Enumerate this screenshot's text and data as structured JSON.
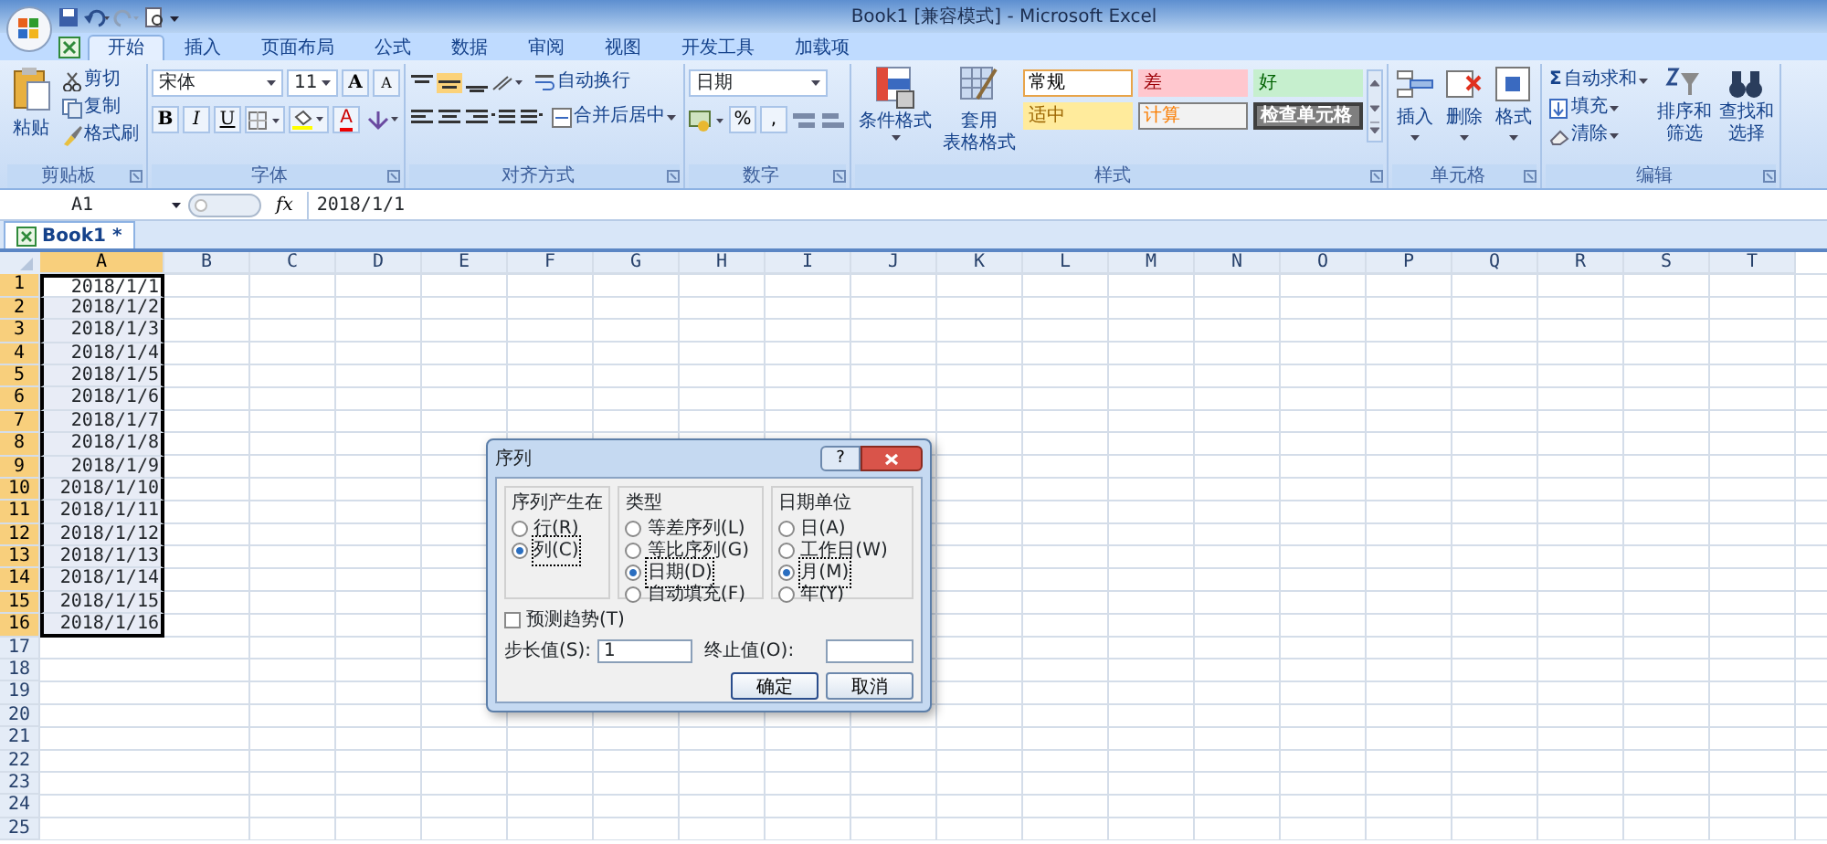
{
  "window": {
    "title": "Book1  [兼容模式] - Microsoft Excel"
  },
  "tabs": [
    {
      "label": "开始",
      "selected": true
    },
    {
      "label": "插入",
      "selected": false
    },
    {
      "label": "页面布局",
      "selected": false
    },
    {
      "label": "公式",
      "selected": false
    },
    {
      "label": "数据",
      "selected": false
    },
    {
      "label": "审阅",
      "selected": false
    },
    {
      "label": "视图",
      "selected": false
    },
    {
      "label": "开发工具",
      "selected": false
    },
    {
      "label": "加载项",
      "selected": false
    }
  ],
  "clipboard": {
    "label": "剪贴板",
    "paste": "粘贴",
    "items": [
      "剪切",
      "复制",
      "格式刷"
    ]
  },
  "font": {
    "label": "字体",
    "name": "宋体",
    "size": "11",
    "grow": "A",
    "shrink": "A",
    "styles": [
      "B",
      "I",
      "U"
    ],
    "color_letter": "A"
  },
  "alignment": {
    "label": "对齐方式",
    "wrap": "自动换行",
    "merge": "合并后居中"
  },
  "number": {
    "label": "数字",
    "format": "日期",
    "percent": "%",
    "comma": ","
  },
  "styles": {
    "label": "样式",
    "conditional": "条件格式",
    "table_lines": [
      "套用",
      "表格格式"
    ],
    "items": [
      {
        "label": "常规",
        "kind": "normal"
      },
      {
        "label": "差",
        "kind": "bad"
      },
      {
        "label": "好",
        "kind": "good"
      },
      {
        "label": "适中",
        "kind": "neutral"
      },
      {
        "label": "计算",
        "kind": "calc"
      },
      {
        "label": "检查单元格",
        "kind": "check"
      }
    ]
  },
  "cells": {
    "label": "单元格",
    "buttons": [
      "插入",
      "删除",
      "格式"
    ]
  },
  "editing": {
    "label": "编辑",
    "sum_symbol": "Σ",
    "items": [
      "自动求和",
      "填充",
      "清除"
    ],
    "buttons": [
      [
        "排序和",
        "筛选"
      ],
      [
        "查找和",
        "选择"
      ]
    ]
  },
  "formula_bar": {
    "name_box": "A1",
    "fx": "fx",
    "formula": "2018/1/1"
  },
  "sheet_tab": {
    "label": "Book1 *"
  },
  "grid": {
    "columns": [
      {
        "label": "A",
        "selected": true
      },
      {
        "label": "B",
        "selected": false
      },
      {
        "label": "C",
        "selected": false
      },
      {
        "label": "D",
        "selected": false
      },
      {
        "label": "E",
        "selected": false
      },
      {
        "label": "F",
        "selected": false
      },
      {
        "label": "G",
        "selected": false
      },
      {
        "label": "H",
        "selected": false
      },
      {
        "label": "I",
        "selected": false
      },
      {
        "label": "J",
        "selected": false
      },
      {
        "label": "K",
        "selected": false
      },
      {
        "label": "L",
        "selected": false
      },
      {
        "label": "M",
        "selected": false
      },
      {
        "label": "N",
        "selected": false
      },
      {
        "label": "O",
        "selected": false
      },
      {
        "label": "P",
        "selected": false
      },
      {
        "label": "Q",
        "selected": false
      },
      {
        "label": "R",
        "selected": false
      },
      {
        "label": "S",
        "selected": false
      },
      {
        "label": "T",
        "selected": false
      }
    ],
    "rows": [
      {
        "label": "1",
        "selected": true,
        "value": "2018/1/1"
      },
      {
        "label": "2",
        "selected": true,
        "value": "2018/1/2"
      },
      {
        "label": "3",
        "selected": true,
        "value": "2018/1/3"
      },
      {
        "label": "4",
        "selected": true,
        "value": "2018/1/4"
      },
      {
        "label": "5",
        "selected": true,
        "value": "2018/1/5"
      },
      {
        "label": "6",
        "selected": true,
        "value": "2018/1/6"
      },
      {
        "label": "7",
        "selected": true,
        "value": "2018/1/7"
      },
      {
        "label": "8",
        "selected": true,
        "value": "2018/1/8"
      },
      {
        "label": "9",
        "selected": true,
        "value": "2018/1/9"
      },
      {
        "label": "10",
        "selected": true,
        "value": "2018/1/10"
      },
      {
        "label": "11",
        "selected": true,
        "value": "2018/1/11"
      },
      {
        "label": "12",
        "selected": true,
        "value": "2018/1/12"
      },
      {
        "label": "13",
        "selected": true,
        "value": "2018/1/13"
      },
      {
        "label": "14",
        "selected": true,
        "value": "2018/1/14"
      },
      {
        "label": "15",
        "selected": true,
        "value": "2018/1/15"
      },
      {
        "label": "16",
        "selected": true,
        "value": "2018/1/16"
      },
      {
        "label": "17",
        "selected": false
      },
      {
        "label": "18",
        "selected": false
      },
      {
        "label": "19",
        "selected": false
      },
      {
        "label": "20",
        "selected": false
      },
      {
        "label": "21",
        "selected": false
      },
      {
        "label": "22",
        "selected": false
      },
      {
        "label": "23",
        "selected": false
      },
      {
        "label": "24",
        "selected": false
      },
      {
        "label": "25",
        "selected": false
      }
    ]
  },
  "dialog": {
    "title": "序列",
    "help": "?",
    "groups": [
      {
        "label": "序列产生在",
        "options": [
          {
            "label": "行(R)",
            "selected": false
          },
          {
            "label": "列(C)",
            "selected": true
          }
        ]
      },
      {
        "label": "类型",
        "options": [
          {
            "label": "等差序列(L)",
            "selected": false
          },
          {
            "label": "等比序列(G)",
            "selected": false
          },
          {
            "label": "日期(D)",
            "selected": true
          },
          {
            "label": "自动填充(F)",
            "selected": false
          }
        ]
      },
      {
        "label": "日期单位",
        "options": [
          {
            "label": "日(A)",
            "selected": false
          },
          {
            "label": "工作日(W)",
            "selected": false
          },
          {
            "label": "月(M)",
            "selected": true
          },
          {
            "label": "年(Y)",
            "selected": false
          }
        ]
      }
    ],
    "trend": {
      "label": "预测趋势(T)",
      "checked": false
    },
    "step": {
      "label": "步长值(S):",
      "value": "1"
    },
    "stop": {
      "label": "终止值(O):"
    },
    "buttons": [
      "确定",
      "取消"
    ]
  }
}
